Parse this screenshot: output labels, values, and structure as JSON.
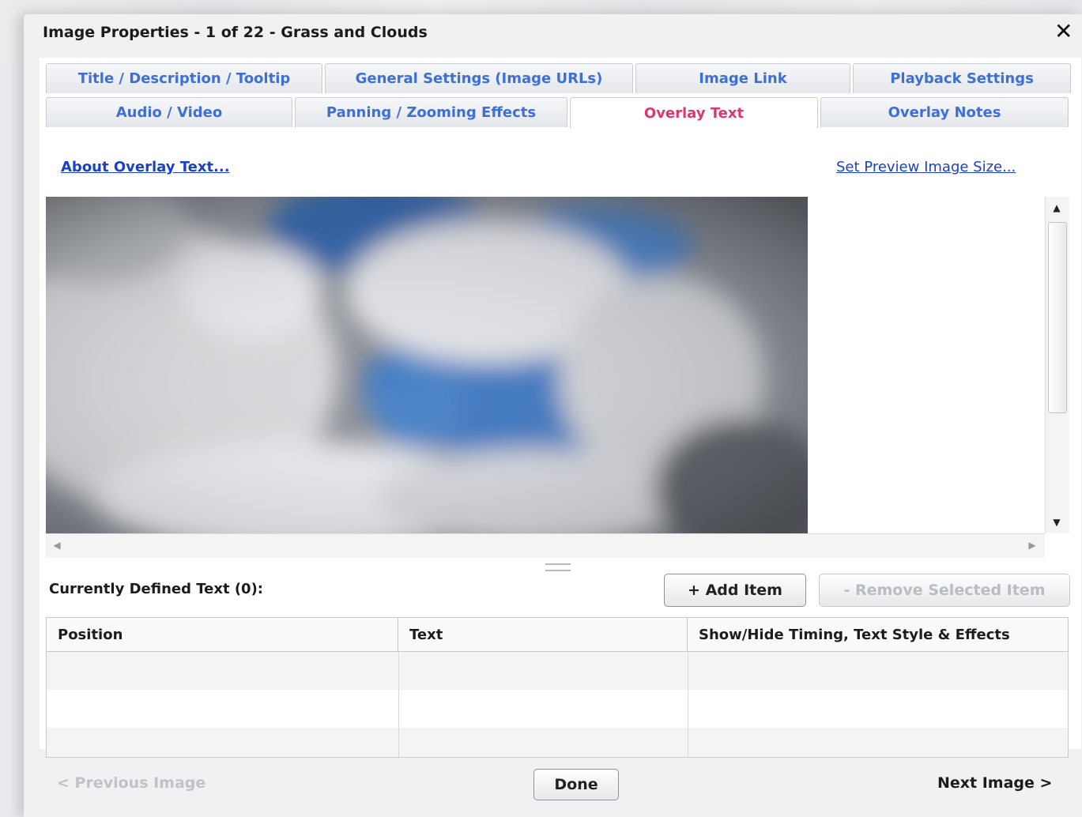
{
  "dialog": {
    "title": "Image Properties - 1 of 22 - Grass and Clouds",
    "close_glyph": "✕"
  },
  "tabs": {
    "row1": [
      {
        "label": "Title / Description / Tooltip"
      },
      {
        "label": "General Settings (Image URLs)"
      },
      {
        "label": "Image Link"
      },
      {
        "label": "Playback Settings"
      }
    ],
    "row2": [
      {
        "label": "Audio / Video"
      },
      {
        "label": "Panning / Zooming Effects"
      },
      {
        "label": "Overlay Text",
        "active": true
      },
      {
        "label": "Overlay Notes"
      }
    ]
  },
  "links": {
    "about": "About Overlay Text...",
    "preview_size": "Set Preview Image Size..."
  },
  "preview": {
    "image_icon": "cloudy-sky-image",
    "scroll_up": "▲",
    "scroll_down": "▼",
    "scroll_left": "◀",
    "scroll_right": "▶"
  },
  "defined_text": {
    "label": "Currently Defined Text (0):",
    "add_button": "+ Add Item",
    "remove_button": "- Remove Selected Item",
    "columns": [
      "Position",
      "Text",
      "Show/Hide Timing, Text Style & Effects"
    ],
    "rows": []
  },
  "footer": {
    "previous": "< Previous Image",
    "done": "Done",
    "next": "Next Image >"
  },
  "colors": {
    "tab_text": "#3e6fd8",
    "active_tab_text": "#e0356f",
    "link": "#1a3fc9",
    "disabled_text": "#bfc2c7"
  }
}
